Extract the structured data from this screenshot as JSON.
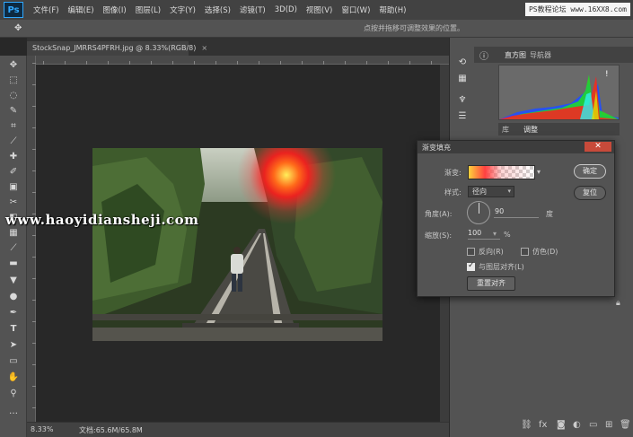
{
  "app": {
    "logo": "Ps"
  },
  "menubar": {
    "items": [
      "文件(F)",
      "编辑(E)",
      "图像(I)",
      "图层(L)",
      "文字(Y)",
      "选择(S)",
      "滤镜(T)",
      "3D(D)",
      "视图(V)",
      "窗口(W)",
      "帮助(H)"
    ],
    "site_watermark": "PS教程论坛 www.16XX8.com"
  },
  "options_bar": {
    "tool_icon": "move-icon",
    "hint": "点按并拖移可调整效果的位置。"
  },
  "document": {
    "tab_title": "StockSnap_JMRRS4PFRH.jpg @ 8.33%(RGB/8)",
    "tab_close": "×",
    "image_icon": "forest-railway-with-red-sun-gradient"
  },
  "status_bar": {
    "zoom": "8.33%",
    "doc_size": "文档:65.6M/65.8M"
  },
  "right_panels": {
    "histogram_tabs": [
      "直方图",
      "导航器"
    ],
    "adjust_tabs": [
      "库",
      "调整"
    ],
    "histogram_colors": {
      "red": "#ff2020",
      "green": "#20e020",
      "blue": "#2050ff",
      "cyan": "#30f0f0",
      "yellow": "#e0e000"
    },
    "warning": "!"
  },
  "dialog": {
    "title": "渐变填充",
    "close": "✕",
    "gradient_label": "渐变:",
    "style_label": "样式:",
    "style_value": "径向",
    "angle_label": "角度(A):",
    "angle_value": "90",
    "angle_unit": "度",
    "scale_label": "缩放(S):",
    "scale_value": "100",
    "scale_unit": "%",
    "reverse_label": "反向(R)",
    "reverse_checked": false,
    "dither_label": "仿色(D)",
    "dither_checked": false,
    "align_label": "与图层对齐(L)",
    "align_checked": true,
    "reset_align_label": "重置对齐",
    "ok_label": "确定",
    "cancel_label": "复位"
  },
  "watermark": "www.haoyidiansheji.com",
  "tools": [
    "move-icon",
    "marquee-icon",
    "lasso-icon",
    "quick-select-icon",
    "crop-icon",
    "eyedropper-icon",
    "healing-icon",
    "brush-icon",
    "stamp-icon",
    "history-brush-icon",
    "eraser-icon",
    "gradient-icon",
    "blur-icon",
    "dodge-icon",
    "pen-icon",
    "type-icon",
    "path-select-icon",
    "shape-icon",
    "hand-icon",
    "zoom-icon"
  ]
}
